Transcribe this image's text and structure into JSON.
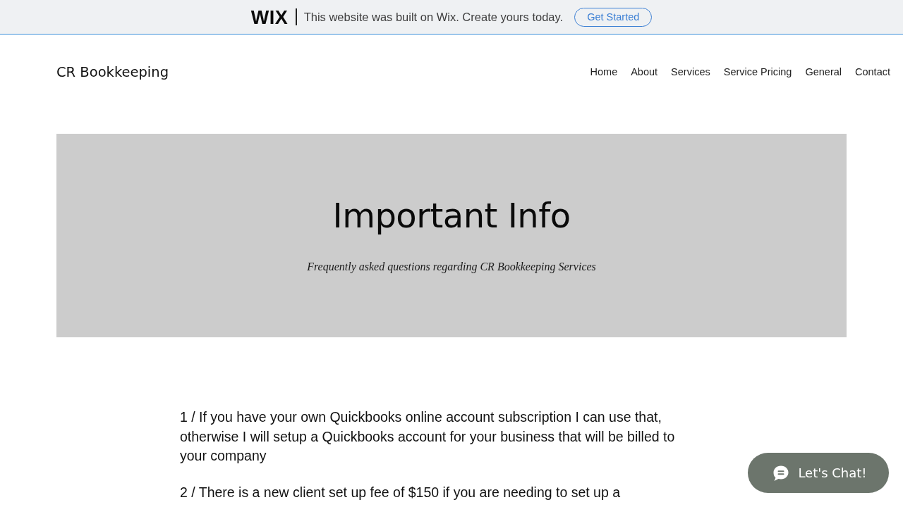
{
  "banner": {
    "logo": "WIX",
    "message": "This website was built on Wix. Create yours today.",
    "button": "Get Started"
  },
  "header": {
    "site_title": "CR Bookkeeping",
    "nav": [
      "Home",
      "About",
      "Services",
      "Service Pricing",
      "General",
      "Contact"
    ]
  },
  "hero": {
    "title": "Important Info",
    "subtitle": "Frequently asked questions regarding CR Bookkeeping Services"
  },
  "faq": [
    "1 / If you have your own Quickbooks online account subscription I can use that, otherwise I will setup a Quickbooks account for your business that will be billed to your company",
    "2 / There is a new client set up fee of $150 if you are needing to set up a"
  ],
  "chat_button": {
    "label": "Let's Chat!"
  }
}
